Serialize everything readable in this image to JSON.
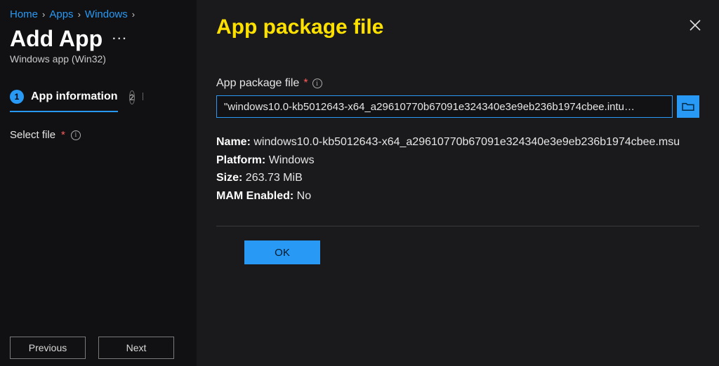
{
  "breadcrumb": {
    "items": [
      "Home",
      "Apps",
      "Windows"
    ]
  },
  "page": {
    "title": "Add App",
    "subtitle": "Windows app (Win32)"
  },
  "wizard": {
    "step1_num": "1",
    "step1_label": "App information",
    "step2_num": "2",
    "step2_label": "P"
  },
  "left_field": {
    "label": "Select file"
  },
  "buttons": {
    "previous": "Previous",
    "next": "Next",
    "ok": "OK"
  },
  "dialog": {
    "title": "App package file",
    "field_label": "App package file",
    "file_value": "\"windows10.0-kb5012643-x64_a29610770b67091e324340e3e9eb236b1974cbee.intu…",
    "props": {
      "name_label": "Name:",
      "name_value": "windows10.0-kb5012643-x64_a29610770b67091e324340e3e9eb236b1974cbee.msu",
      "platform_label": "Platform:",
      "platform_value": "Windows",
      "size_label": "Size:",
      "size_value": "263.73 MiB",
      "mam_label": "MAM Enabled:",
      "mam_value": "No"
    }
  }
}
